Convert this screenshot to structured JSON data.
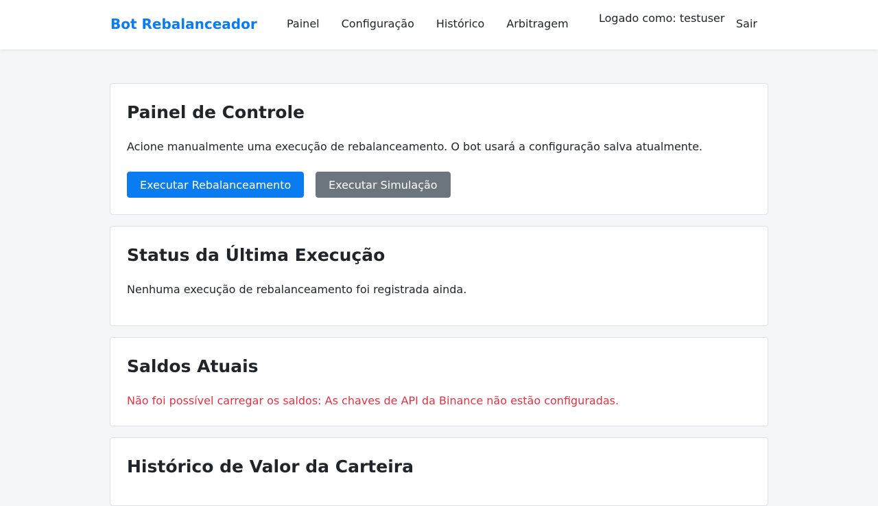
{
  "navbar": {
    "brand": "Bot Rebalanceador",
    "links": [
      "Painel",
      "Configuração",
      "Histórico",
      "Arbitragem"
    ],
    "logged_in": "Logado como: testuser",
    "logout": "Sair"
  },
  "control_panel": {
    "title": "Painel de Controle",
    "description": "Acione manualmente uma execução de rebalanceamento. O bot usará a configuração salva atualmente.",
    "run_button": "Executar Rebalanceamento",
    "simulate_button": "Executar Simulação"
  },
  "last_run": {
    "title": "Status da Última Execução",
    "message": "Nenhuma execução de rebalanceamento foi registrada ainda."
  },
  "balances": {
    "title": "Saldos Atuais",
    "error": "Não foi possível carregar os saldos: As chaves de API da Binance não estão configuradas."
  },
  "portfolio_history": {
    "title": "Histórico de Valor da Carteira"
  },
  "colors": {
    "primary": "#0a7cf2",
    "secondary": "#6c757d",
    "danger": "#dc3545",
    "background": "#f5f6f8"
  }
}
